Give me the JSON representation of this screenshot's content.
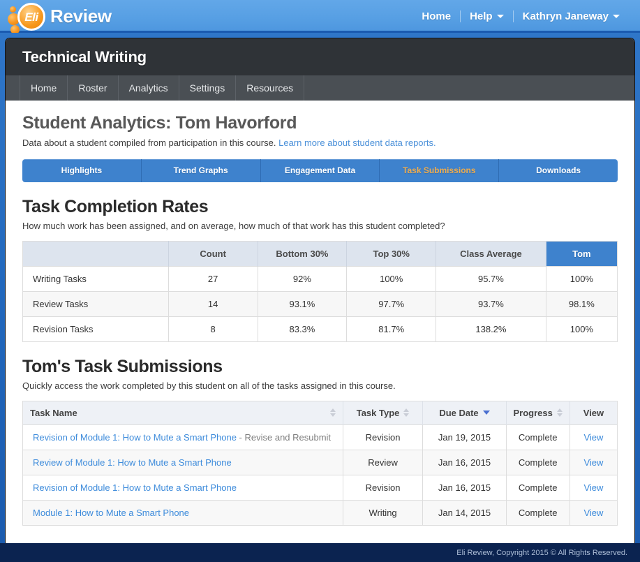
{
  "brand": {
    "logo_text": "Eli",
    "logo_word": "Review",
    "icon": "eli-logo-icon"
  },
  "topnav": {
    "items": [
      {
        "label": "Home",
        "caret": false
      },
      {
        "label": "Help",
        "caret": true
      },
      {
        "label": "Kathryn Janeway",
        "caret": true
      }
    ]
  },
  "course": {
    "title": "Technical Writing",
    "nav": [
      "Home",
      "Roster",
      "Analytics",
      "Settings",
      "Resources"
    ]
  },
  "page": {
    "title": "Student Analytics: Tom Havorford",
    "subtitle_text": "Data about a student compiled from participation in this course.",
    "subtitle_link": "Learn more about student data reports."
  },
  "tabs": [
    {
      "label": "Highlights",
      "active": false
    },
    {
      "label": "Trend Graphs",
      "active": false
    },
    {
      "label": "Engagement Data",
      "active": false
    },
    {
      "label": "Task Submissions",
      "active": true
    },
    {
      "label": "Downloads",
      "active": false
    }
  ],
  "rates_section": {
    "title": "Task Completion Rates",
    "subtitle": "How much work has been assigned, and on average, how much of that work has this student completed?",
    "headers": [
      "",
      "Count",
      "Bottom 30%",
      "Top 30%",
      "Class Average",
      "Tom"
    ],
    "rows": [
      {
        "label": "Writing Tasks",
        "count": "27",
        "bottom30": "92%",
        "top30": "100%",
        "class_average": "95.7%",
        "student": "100%"
      },
      {
        "label": "Review Tasks",
        "count": "14",
        "bottom30": "93.1%",
        "top30": "97.7%",
        "class_average": "93.7%",
        "student": "98.1%"
      },
      {
        "label": "Revision Tasks",
        "count": "8",
        "bottom30": "83.3%",
        "top30": "81.7%",
        "class_average": "138.2%",
        "student": "100%"
      }
    ]
  },
  "submissions_section": {
    "title": "Tom's Task Submissions",
    "subtitle": "Quickly access the work completed by this student on all of the tasks assigned in this course.",
    "headers": [
      {
        "label": "Task Name",
        "sort": "both"
      },
      {
        "label": "Task Type",
        "sort": "both"
      },
      {
        "label": "Due Date",
        "sort": "desc"
      },
      {
        "label": "Progress",
        "sort": "both"
      },
      {
        "label": "View",
        "sort": "none"
      }
    ],
    "rows": [
      {
        "name": "Revision of Module 1: How to Mute a Smart Phone",
        "suffix": " - Revise and Resubmit",
        "type": "Revision",
        "due": "Jan 19, 2015",
        "progress": "Complete",
        "view": "View"
      },
      {
        "name": "Review of Module 1: How to Mute a Smart Phone",
        "suffix": "",
        "type": "Review",
        "due": "Jan 16, 2015",
        "progress": "Complete",
        "view": "View"
      },
      {
        "name": "Revision of Module 1: How to Mute a Smart Phone",
        "suffix": "",
        "type": "Revision",
        "due": "Jan 16, 2015",
        "progress": "Complete",
        "view": "View"
      },
      {
        "name": "Module 1: How to Mute a Smart Phone",
        "suffix": "",
        "type": "Writing",
        "due": "Jan 14, 2015",
        "progress": "Complete",
        "view": "View"
      }
    ]
  },
  "footer": {
    "copyright": "Eli Review, Copyright 2015 © All Rights Reserved."
  },
  "colors": {
    "brand_blue": "#58a0e4",
    "page_blue": "#2268bd",
    "accent_orange": "#f0ad4e",
    "link_blue": "#3d8bdb",
    "dark_header": "#2f3337",
    "footer_navy": "#0b2350"
  }
}
